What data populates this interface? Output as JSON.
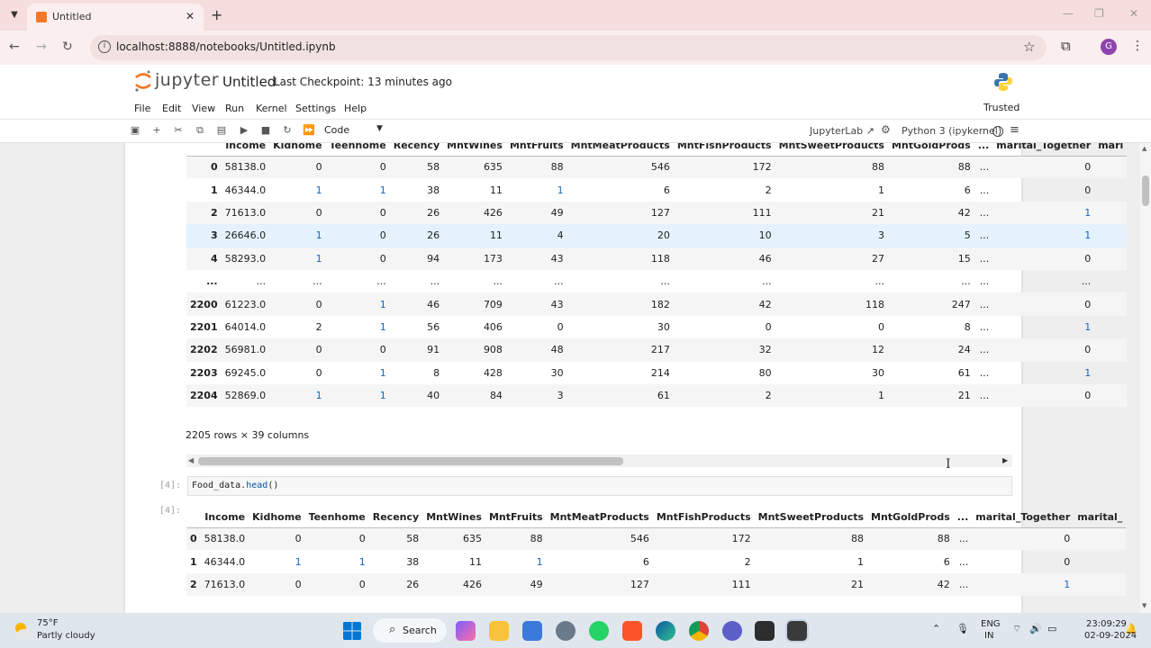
{
  "browser": {
    "tab_title": "Untitled",
    "url": "localhost:8888/notebooks/Untitled.ipynb",
    "profile_initial": "G"
  },
  "jupyter": {
    "brand": "jupyter",
    "notebook_title": "Untitled",
    "checkpoint": "Last Checkpoint: 13 minutes ago",
    "menu": [
      "File",
      "Edit",
      "View",
      "Run",
      "Kernel",
      "Settings",
      "Help"
    ],
    "trusted": "Trusted",
    "cell_type": "Code",
    "jupyterlab_link": "JupyterLab",
    "kernel": "Python 3 (ipykernel)"
  },
  "output1": {
    "columns": [
      "",
      "Income",
      "Kidhome",
      "Teenhome",
      "Recency",
      "MntWines",
      "MntFruits",
      "MntMeatProducts",
      "MntFishProducts",
      "MntSweetProducts",
      "MntGoldProds",
      "...",
      "marital_Together",
      "mari"
    ],
    "rows": [
      [
        "0",
        "58138.0",
        "0",
        "0",
        "58",
        "635",
        "88",
        "546",
        "172",
        "88",
        "88",
        "...",
        "0"
      ],
      [
        "1",
        "46344.0",
        "1",
        "1",
        "38",
        "11",
        "1",
        "6",
        "2",
        "1",
        "6",
        "...",
        "0"
      ],
      [
        "2",
        "71613.0",
        "0",
        "0",
        "26",
        "426",
        "49",
        "127",
        "111",
        "21",
        "42",
        "...",
        "1"
      ],
      [
        "3",
        "26646.0",
        "1",
        "0",
        "26",
        "11",
        "4",
        "20",
        "10",
        "3",
        "5",
        "...",
        "1"
      ],
      [
        "4",
        "58293.0",
        "1",
        "0",
        "94",
        "173",
        "43",
        "118",
        "46",
        "27",
        "15",
        "...",
        "0"
      ],
      [
        "...",
        "...",
        "...",
        "...",
        "...",
        "...",
        "...",
        "...",
        "...",
        "...",
        "...",
        "...",
        "..."
      ],
      [
        "2200",
        "61223.0",
        "0",
        "1",
        "46",
        "709",
        "43",
        "182",
        "42",
        "118",
        "247",
        "...",
        "0"
      ],
      [
        "2201",
        "64014.0",
        "2",
        "1",
        "56",
        "406",
        "0",
        "30",
        "0",
        "0",
        "8",
        "...",
        "1"
      ],
      [
        "2202",
        "56981.0",
        "0",
        "0",
        "91",
        "908",
        "48",
        "217",
        "32",
        "12",
        "24",
        "...",
        "0"
      ],
      [
        "2203",
        "69245.0",
        "0",
        "1",
        "8",
        "428",
        "30",
        "214",
        "80",
        "30",
        "61",
        "...",
        "1"
      ],
      [
        "2204",
        "52869.0",
        "1",
        "1",
        "40",
        "84",
        "3",
        "61",
        "2",
        "1",
        "21",
        "...",
        "0"
      ]
    ],
    "rows_info": "2205 rows × 39 columns"
  },
  "cell4": {
    "in_prompt": "[4]:",
    "out_prompt": "[4]:",
    "code_var": "Food_data.",
    "code_fn": "head",
    "code_end": "()"
  },
  "output2": {
    "columns": [
      "",
      "Income",
      "Kidhome",
      "Teenhome",
      "Recency",
      "MntWines",
      "MntFruits",
      "MntMeatProducts",
      "MntFishProducts",
      "MntSweetProducts",
      "MntGoldProds",
      "...",
      "marital_Together",
      "marital_"
    ],
    "rows": [
      [
        "0",
        "58138.0",
        "0",
        "0",
        "58",
        "635",
        "88",
        "546",
        "172",
        "88",
        "88",
        "...",
        "0"
      ],
      [
        "1",
        "46344.0",
        "1",
        "1",
        "38",
        "11",
        "1",
        "6",
        "2",
        "1",
        "6",
        "...",
        "0"
      ],
      [
        "2",
        "71613.0",
        "0",
        "0",
        "26",
        "426",
        "49",
        "127",
        "111",
        "21",
        "42",
        "...",
        "1"
      ]
    ]
  },
  "taskbar": {
    "temp": "75°F",
    "weather": "Partly cloudy",
    "search": "Search",
    "lang1": "ENG",
    "lang2": "IN",
    "time": "23:09:29",
    "date": "02-09-2024"
  }
}
